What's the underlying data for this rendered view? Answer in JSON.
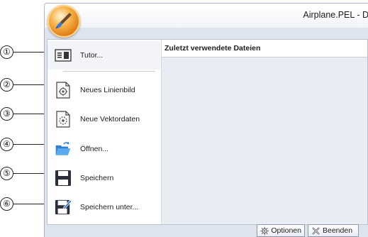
{
  "window": {
    "title": "Airplane.PEL - D"
  },
  "menu": {
    "items": [
      {
        "label": "Tutor...",
        "icon": "tutor-icon"
      },
      {
        "label": "Neues Linienbild",
        "icon": "new-line-image-icon"
      },
      {
        "label": "Neue Vektordaten",
        "icon": "new-vector-data-icon"
      },
      {
        "label": "Öffnen...",
        "icon": "open-folder-icon"
      },
      {
        "label": "Speichern",
        "icon": "save-disk-icon"
      },
      {
        "label": "Speichern unter...",
        "icon": "save-as-icon"
      }
    ]
  },
  "recent": {
    "header": "Zuletzt verwendete Dateien"
  },
  "footer": {
    "options_label": "Optionen",
    "exit_label": "Beenden"
  },
  "callouts": [
    "①",
    "②",
    "③",
    "④",
    "⑤",
    "⑥"
  ],
  "colors": {
    "orb": "#f0922a",
    "panel_bg": "#dde4ee",
    "folder": "#3a8fd9",
    "disk": "#2b2f3a"
  }
}
